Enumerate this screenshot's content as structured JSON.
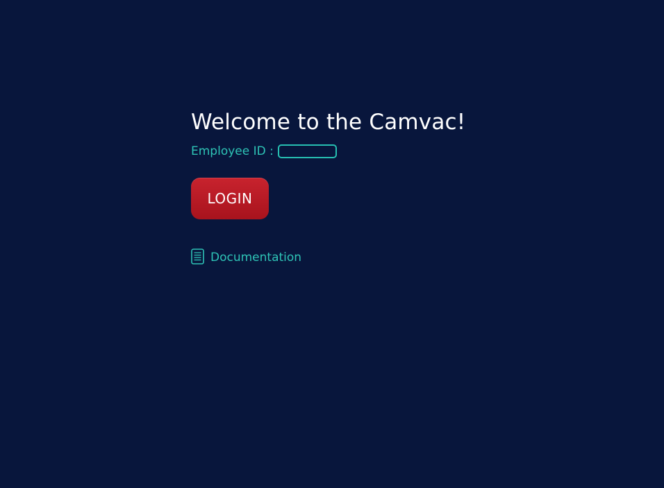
{
  "login": {
    "title": "Welcome to the Camvac!",
    "employee_id_label": "Employee ID :",
    "employee_id_value": "",
    "login_button_label": "LOGIN",
    "documentation_label": "Documentation",
    "documentation_icon": "document-icon"
  },
  "colors": {
    "background": "#08163c",
    "accent_teal": "#2ec4b6",
    "button_red": "#b81a24",
    "title_white": "#ffffff"
  }
}
